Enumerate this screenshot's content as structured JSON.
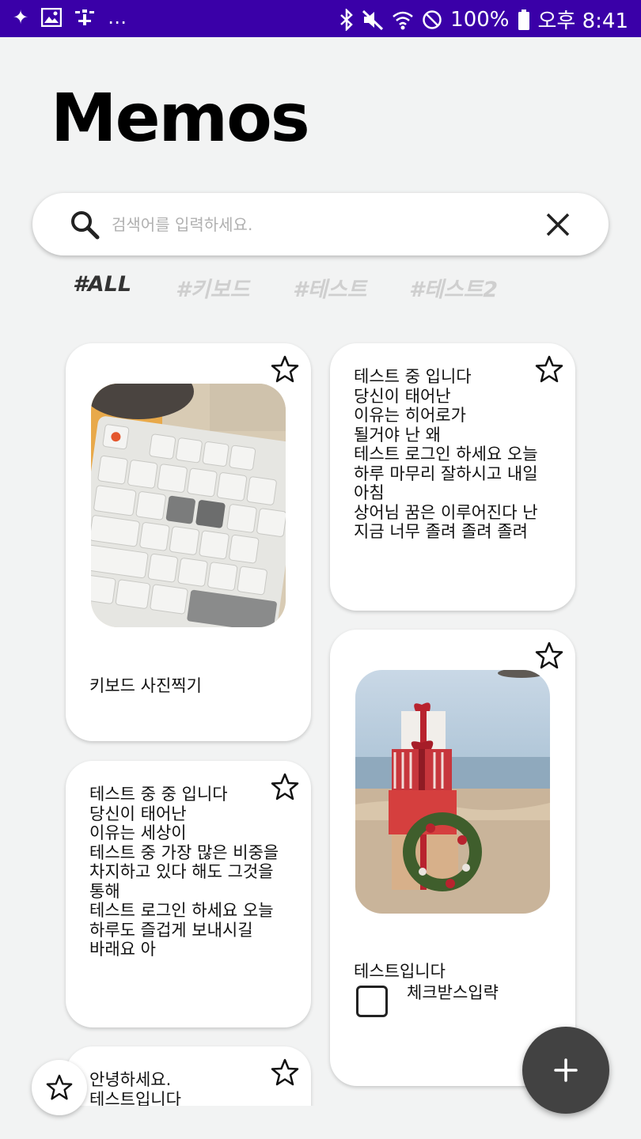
{
  "status_bar": {
    "battery": "100%",
    "time": "오후 8:41",
    "left_icons": [
      "sparkle-icon",
      "gallery-icon",
      "accessibility-icon",
      "more-dots"
    ],
    "right_icons": [
      "bluetooth-icon",
      "mute-icon",
      "wifi-icon",
      "block-icon",
      "battery-icon"
    ]
  },
  "app": {
    "title": "Memos"
  },
  "search": {
    "placeholder": "검색어를 입력하세요.",
    "value": ""
  },
  "tags": [
    {
      "label": "#ALL",
      "active": true
    },
    {
      "label": "#키보드",
      "active": false
    },
    {
      "label": "#테스트",
      "active": false
    },
    {
      "label": "#테스트2",
      "active": false
    }
  ],
  "memos": [
    {
      "text": "키보드 사진찍기",
      "image": "keyboard-photo",
      "starred": false
    },
    {
      "text": "테스트 중 입니다\n당신이 태어난\n이유는 히어로가\n될거야 난 왜\n테스트 로그인 하세요 오늘\n하루 마무리 잘하시고 내일\n아침\n상어님 꿈은 이루어진다 난\n지금 너무 졸려 졸려 졸려",
      "starred": false
    },
    {
      "text": "테스트 중 중 입니다\n당신이 태어난\n이유는 세상이\n테스트 중 가장 많은 비중을\n차지하고 있다 해도 그것을\n통해\n테스트 로그인 하세요 오늘\n하루도 즐겁게 보내시길\n바래요 아",
      "starred": false
    },
    {
      "text": "테스트입니다",
      "image": "gift-beach-photo",
      "checkbox_label": "체크받스입략",
      "checked": false,
      "starred": false
    },
    {
      "text": "안녕하세요.\n테스트입니다",
      "starred": false
    }
  ],
  "colors": {
    "status_bar": "#3a00a8",
    "background": "#f2f3f3",
    "fab": "#424242",
    "tag_inactive": "#cfcfcf",
    "tag_active": "#333333"
  }
}
